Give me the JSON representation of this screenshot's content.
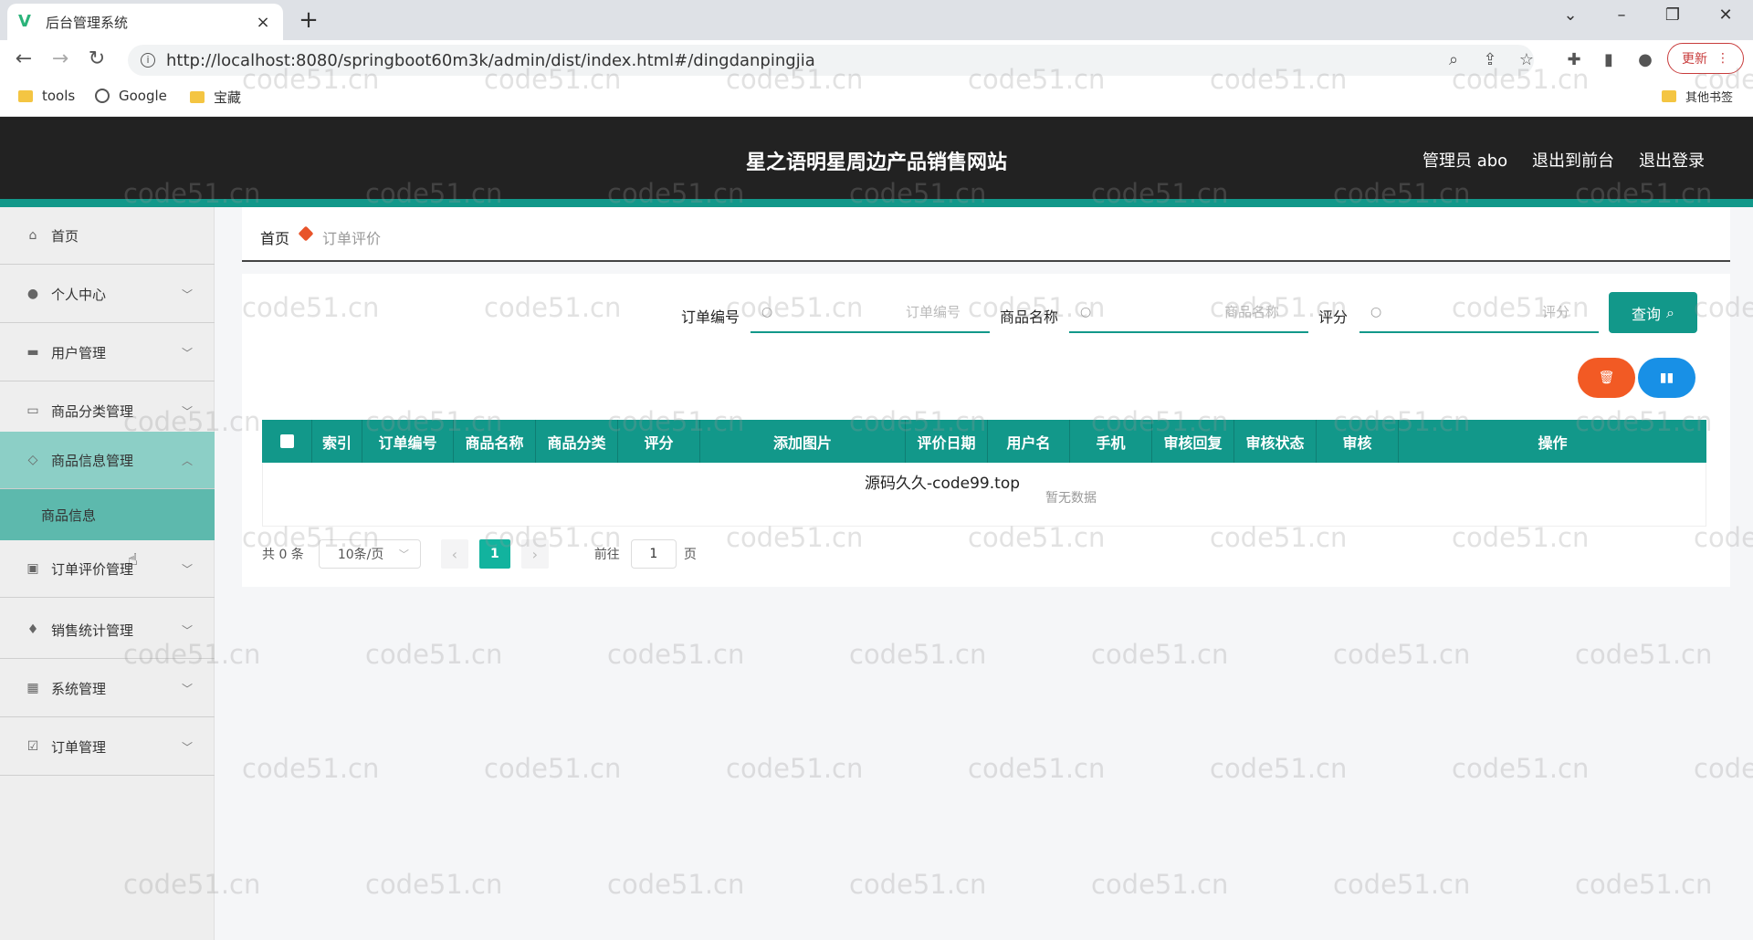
{
  "browser": {
    "tab_title": "后台管理系统",
    "tab_close": "×",
    "new_tab": "+",
    "url": "http://localhost:8080/springboot60m3k/admin/dist/index.html#/dingdanpingjia",
    "update_label": "更新",
    "bookmarks": [
      "tools",
      "Google",
      "宝藏"
    ],
    "other_bookmarks": "其他书签"
  },
  "header": {
    "title": "星之语明星周边产品销售网站",
    "user": "管理员 abo",
    "to_front": "退出到前台",
    "logout": "退出登录"
  },
  "sidebar": {
    "items": [
      {
        "label": "首页",
        "icon": "home-icon"
      },
      {
        "label": "个人中心",
        "icon": "user-icon"
      },
      {
        "label": "用户管理",
        "icon": "users-icon"
      },
      {
        "label": "商品分类管理",
        "icon": "category-icon"
      },
      {
        "label": "商品信息管理",
        "icon": "goods-icon"
      },
      {
        "label": "订单评价管理",
        "icon": "review-icon"
      },
      {
        "label": "销售统计管理",
        "icon": "stats-icon"
      },
      {
        "label": "系统管理",
        "icon": "grid-icon"
      },
      {
        "label": "订单管理",
        "icon": "order-icon"
      }
    ],
    "sub_item": "商品信息"
  },
  "breadcrumb": {
    "home": "首页",
    "current": "订单评价"
  },
  "search": {
    "order_no_label": "订单编号",
    "order_no_placeholder": "订单编号",
    "goods_name_label": "商品名称",
    "goods_name_placeholder": "商品名称",
    "rating_label": "评分",
    "rating_placeholder": "评分",
    "query_label": "查询"
  },
  "table": {
    "columns": [
      "索引",
      "订单编号",
      "商品名称",
      "商品分类",
      "评分",
      "添加图片",
      "评价日期",
      "用户名",
      "手机",
      "审核回复",
      "审核状态",
      "审核",
      "操作"
    ],
    "overlay_text": "源码久久-code99.top",
    "empty_text": "暂无数据"
  },
  "pagination": {
    "total": "共 0 条",
    "page_size": "10条/页",
    "current": "1",
    "goto_label": "前往",
    "goto_value": "1",
    "page_suffix": "页"
  },
  "watermark": "code51.cn",
  "colors": {
    "accent": "#12988a",
    "danger": "#f25a24",
    "primary": "#1890e6",
    "header_bg": "#222222"
  }
}
